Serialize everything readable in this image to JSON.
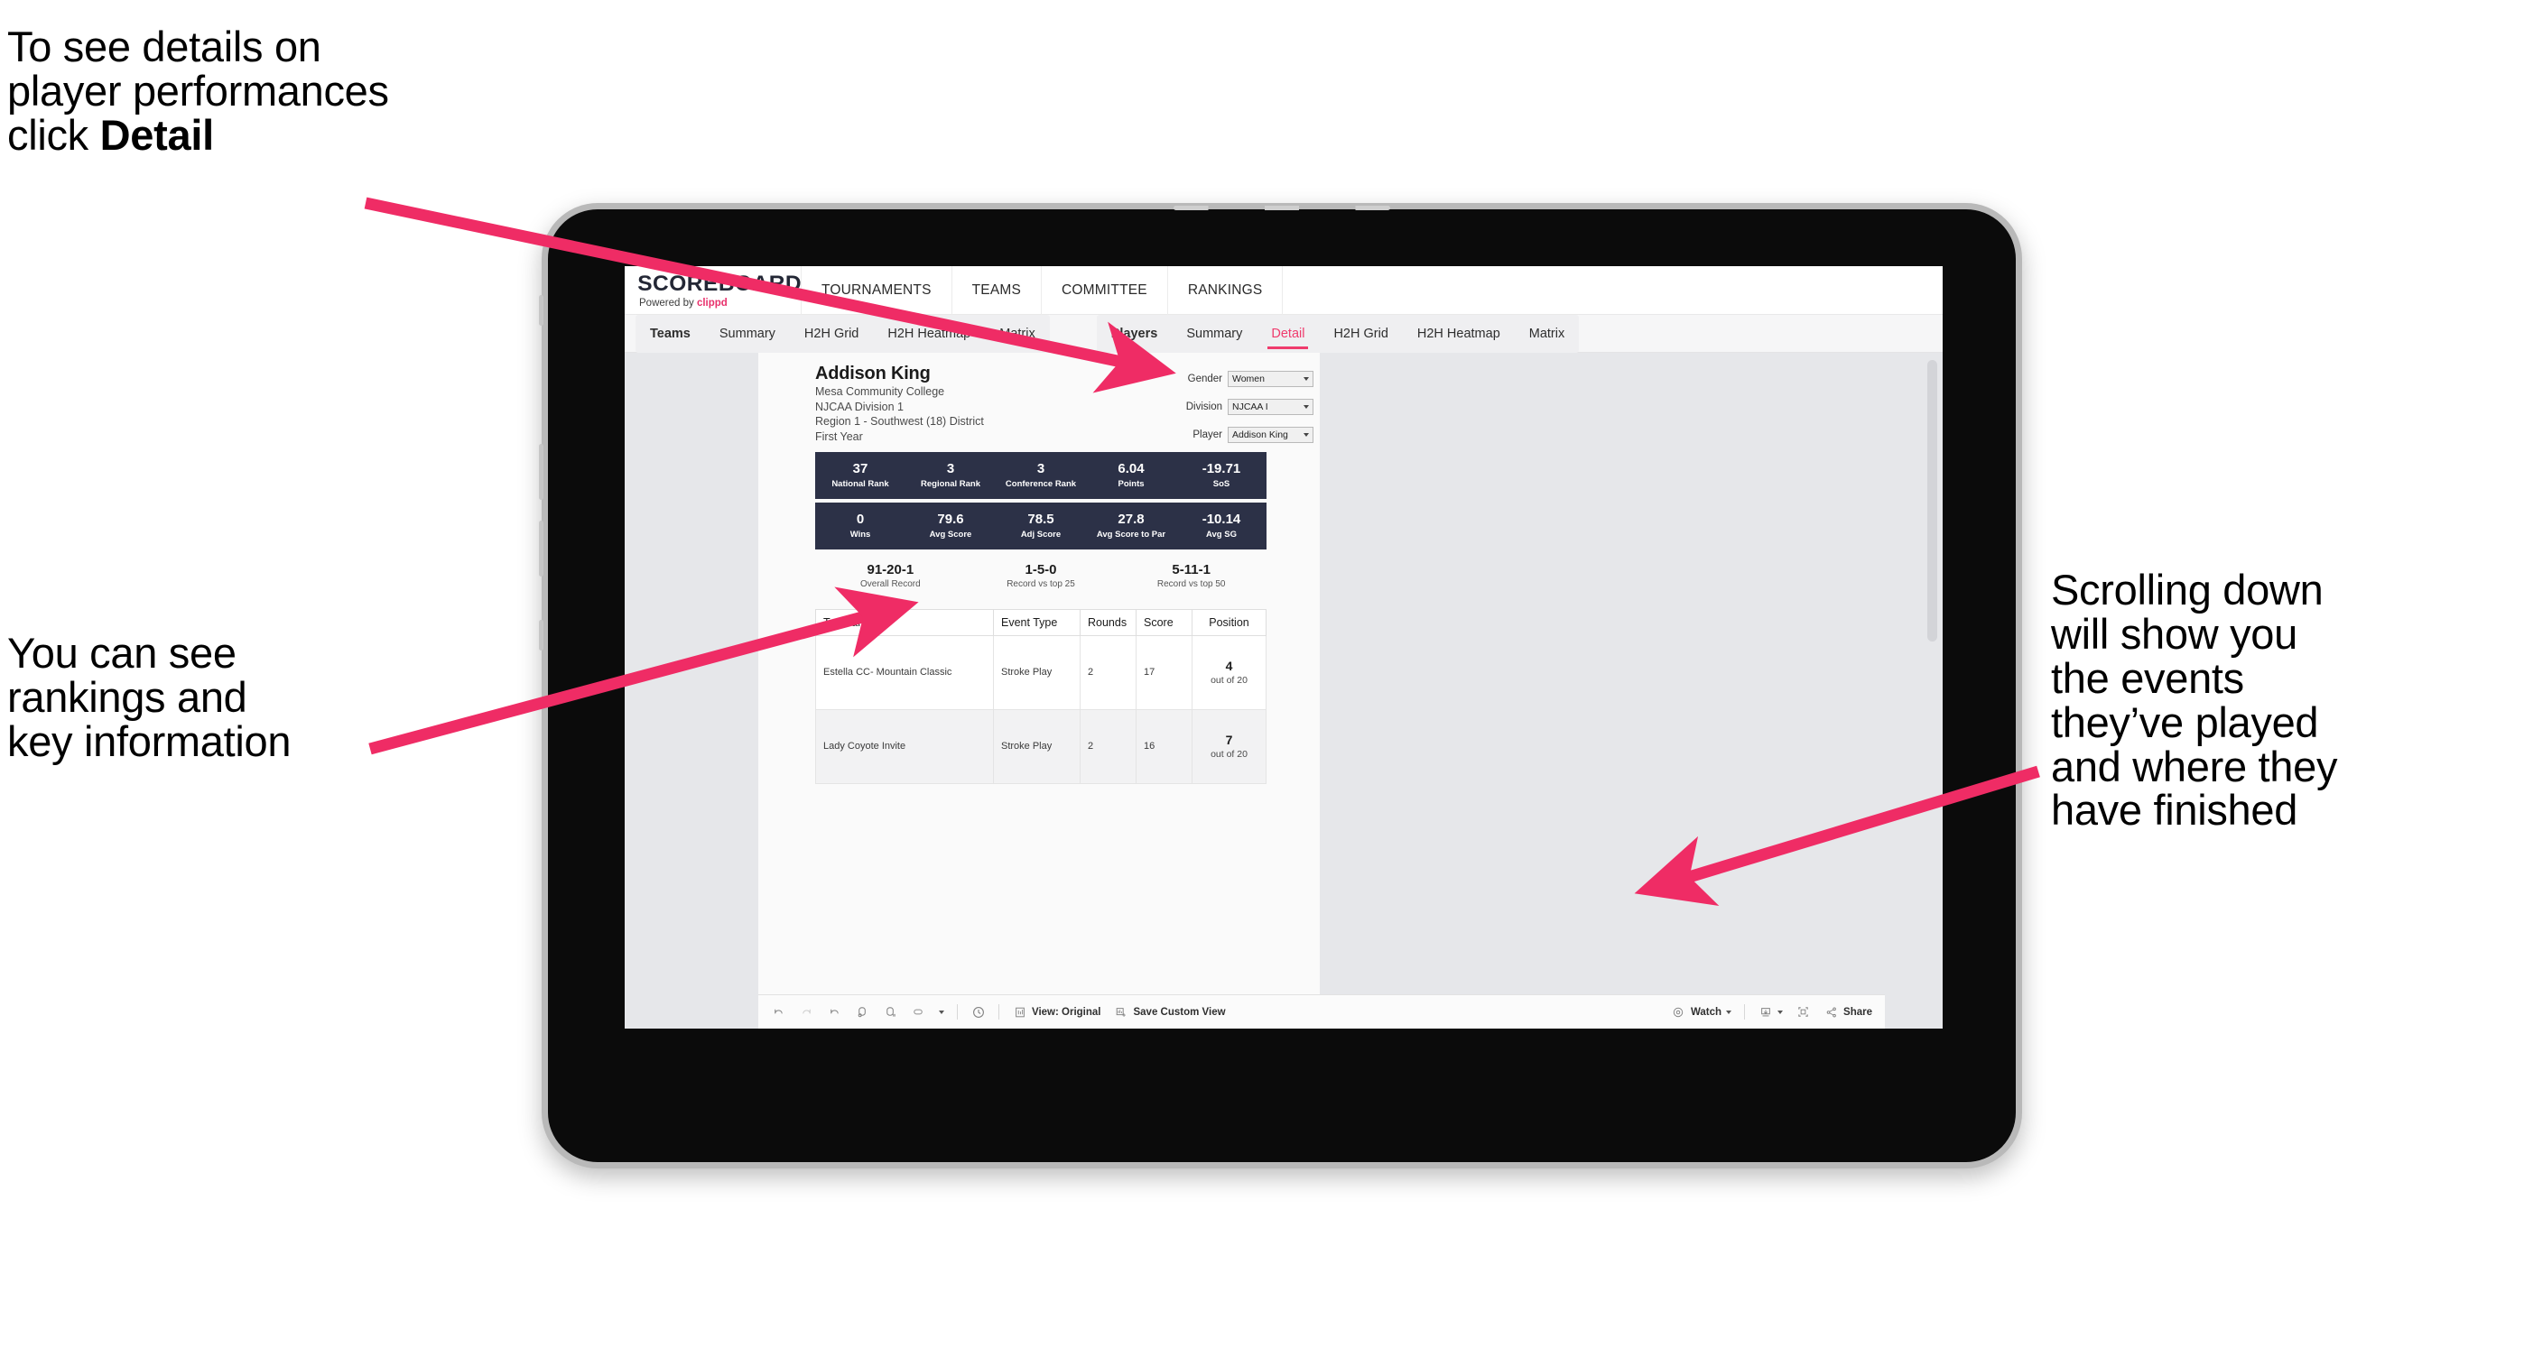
{
  "annotations": {
    "detail_hint_line1": "To see details on",
    "detail_hint_line2": "player performances",
    "detail_hint_line3_prefix": "click ",
    "detail_hint_line3_bold": "Detail",
    "rankings_hint": "You can see\nrankings and\nkey information",
    "scrolling_hint": "Scrolling down\nwill show you\nthe events\nthey’ve played\nand where they\nhave finished",
    "arrow_color": "#ef2c65"
  },
  "app": {
    "brand": {
      "title": "SCOREBOARD",
      "powered_prefix": "Powered by ",
      "powered_brand": "clippd"
    },
    "top_nav": [
      {
        "label": "TOURNAMENTS"
      },
      {
        "label": "TEAMS"
      },
      {
        "label": "COMMITTEE"
      },
      {
        "label": "RANKINGS"
      }
    ],
    "sub_nav": {
      "group_teams": [
        {
          "label": "Teams",
          "lead": true,
          "active": false
        },
        {
          "label": "Summary",
          "lead": false,
          "active": false
        },
        {
          "label": "H2H Grid",
          "lead": false,
          "active": false
        },
        {
          "label": "H2H Heatmap",
          "lead": false,
          "active": false
        },
        {
          "label": "Matrix",
          "lead": false,
          "active": false
        }
      ],
      "group_players": [
        {
          "label": "Players",
          "lead": true,
          "active": false
        },
        {
          "label": "Summary",
          "lead": false,
          "active": false
        },
        {
          "label": "Detail",
          "lead": false,
          "active": true
        },
        {
          "label": "H2H Grid",
          "lead": false,
          "active": false
        },
        {
          "label": "H2H Heatmap",
          "lead": false,
          "active": false
        },
        {
          "label": "Matrix",
          "lead": false,
          "active": false
        }
      ]
    },
    "accent_color": "#ef3b6d",
    "band_color": "#2c3147"
  },
  "player": {
    "name": "Addison King",
    "school": "Mesa Community College",
    "division": "NJCAA Division 1",
    "region": "Region 1 - Southwest (18) District",
    "year": "First Year"
  },
  "filters": [
    {
      "label": "Gender",
      "value": "Women"
    },
    {
      "label": "Division",
      "value": "NJCAA I"
    },
    {
      "label": "Player",
      "value": "Addison King"
    }
  ],
  "stats_row1": [
    {
      "value": "37",
      "label": "National Rank"
    },
    {
      "value": "3",
      "label": "Regional Rank"
    },
    {
      "value": "3",
      "label": "Conference Rank"
    },
    {
      "value": "6.04",
      "label": "Points"
    },
    {
      "value": "-19.71",
      "label": "SoS"
    }
  ],
  "stats_row2": [
    {
      "value": "0",
      "label": "Wins"
    },
    {
      "value": "79.6",
      "label": "Avg Score"
    },
    {
      "value": "78.5",
      "label": "Adj Score"
    },
    {
      "value": "27.8",
      "label": "Avg Score to Par"
    },
    {
      "value": "-10.14",
      "label": "Avg SG"
    }
  ],
  "records": [
    {
      "value": "91-20-1",
      "label": "Overall Record"
    },
    {
      "value": "1-5-0",
      "label": "Record vs top 25"
    },
    {
      "value": "5-11-1",
      "label": "Record vs top 50"
    }
  ],
  "tournaments_table": {
    "headers": [
      "Tournament",
      "Event Type",
      "Rounds",
      "Score",
      "Position"
    ],
    "rows": [
      {
        "tournament": "Estella CC- Mountain Classic",
        "event_type": "Stroke Play",
        "rounds": "2",
        "score": "17",
        "position_value": "4",
        "position_out_of": "out of 20"
      },
      {
        "tournament": "Lady Coyote Invite",
        "event_type": "Stroke Play",
        "rounds": "2",
        "score": "16",
        "position_value": "7",
        "position_out_of": "out of 20"
      }
    ]
  },
  "toolbar": {
    "view_label": "View: Original",
    "save_label": "Save Custom View",
    "watch_label": "Watch",
    "share_label": "Share"
  }
}
